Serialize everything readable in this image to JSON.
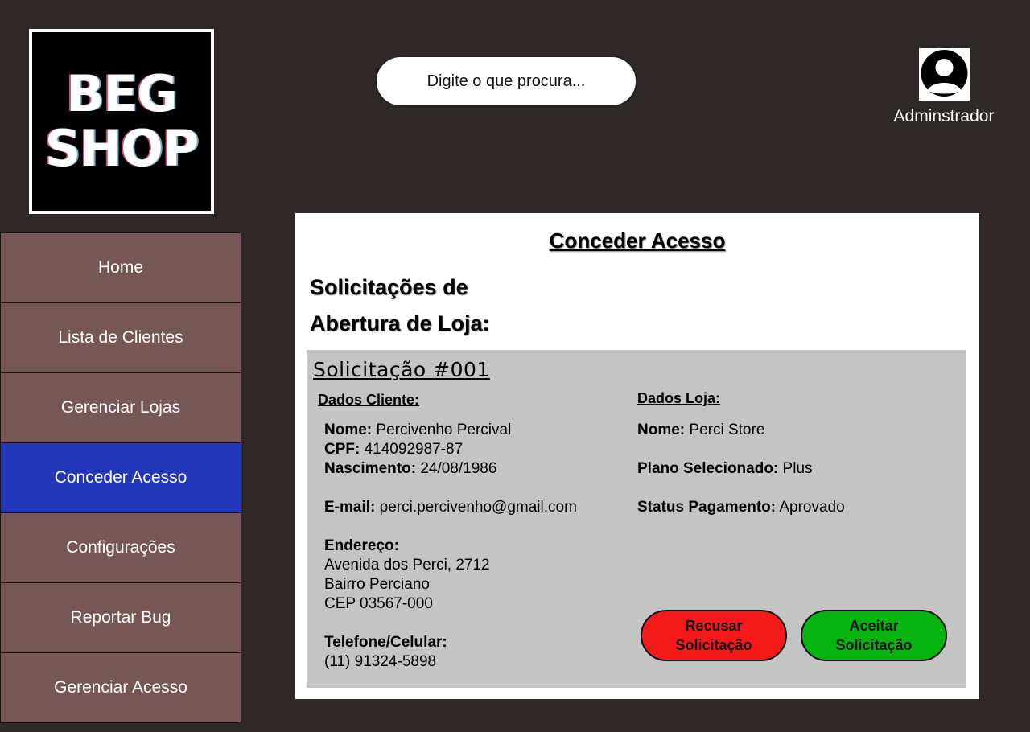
{
  "logo": {
    "line1": "BEG",
    "line2": "SHOP"
  },
  "search": {
    "placeholder": "Digite o que procura..."
  },
  "user": {
    "name": "Adminstrador",
    "icon": "user-avatar-icon"
  },
  "sidebar": {
    "items": [
      {
        "label": "Home"
      },
      {
        "label": "Lista de Clientes"
      },
      {
        "label": "Gerenciar Lojas"
      },
      {
        "label": "Conceder Acesso",
        "active": true
      },
      {
        "label": "Configurações"
      },
      {
        "label": "Reportar Bug"
      },
      {
        "label": "Gerenciar Acesso"
      }
    ]
  },
  "main": {
    "title": "Conceder Acesso",
    "section_title_line1": "Solicitações de",
    "section_title_line2": "Abertura de Loja:",
    "request": {
      "title": "Solicitação #001",
      "client_header": "Dados Cliente:",
      "store_header": "Dados Loja:",
      "client": {
        "name_label": "Nome:",
        "name": "Percivenho Percival",
        "cpf_label": "CPF:",
        "cpf": "414092987-87",
        "birth_label": "Nascimento:",
        "birth": "24/08/1986",
        "email_label": "E-mail:",
        "email": "perci.percivenho@gmail.com",
        "address_label": "Endereço:",
        "address_line1": "Avenida dos Perci, 2712",
        "address_line2": "Bairro Perciano",
        "address_line3": "CEP 03567-000",
        "phone_label": "Telefone/Celular:",
        "phone": "(11) 91324-5898"
      },
      "store": {
        "name_label": "Nome:",
        "name": "Perci Store",
        "plan_label": "Plano Selecionado:",
        "plan": "Plus",
        "payment_label": "Status Pagamento:",
        "payment": "Aprovado"
      },
      "reject_line1": "Recusar",
      "reject_line2": "Solicitação",
      "accept_line1": "Aceitar",
      "accept_line2": "Solicitação"
    }
  },
  "colors": {
    "background": "#2e2828",
    "sidebar": "#765756",
    "sidebar_active": "#2437bb",
    "reject": "#f51a1a",
    "accept": "#07b30e"
  }
}
